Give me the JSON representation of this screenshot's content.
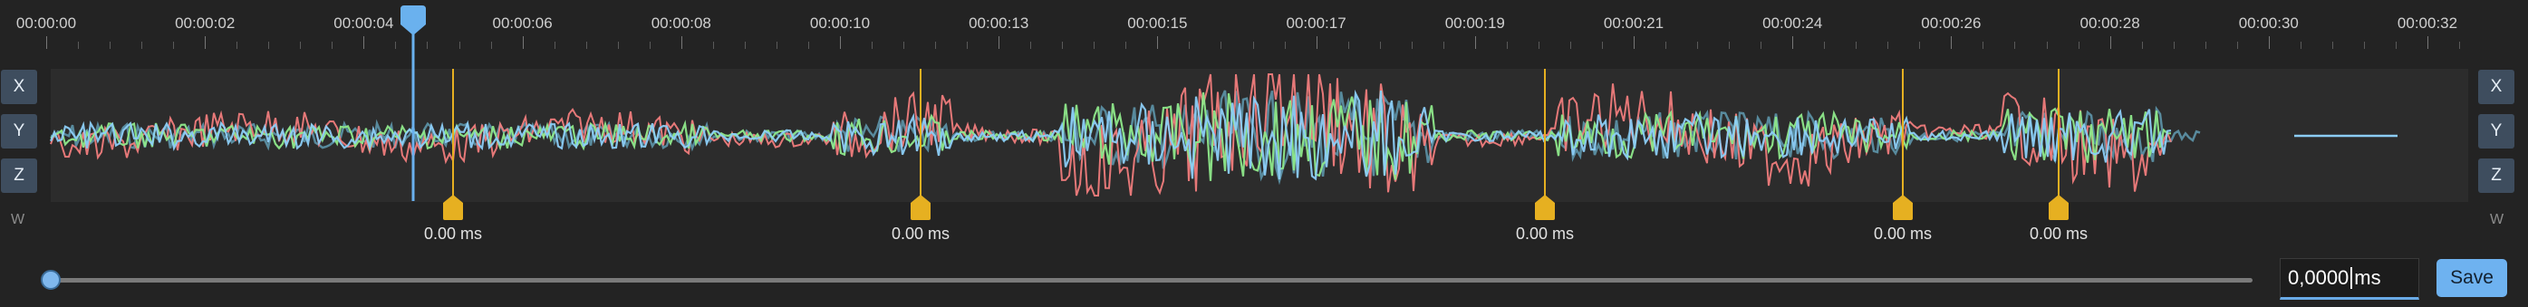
{
  "timeline": {
    "labels": [
      "00:00:00",
      "00:00:02",
      "00:00:04",
      "00:00:06",
      "00:00:08",
      "00:00:10",
      "00:00:13",
      "00:00:15",
      "00:00:17",
      "00:00:19",
      "00:00:21",
      "00:00:24",
      "00:00:26",
      "00:00:28",
      "00:00:30",
      "00:00:32"
    ]
  },
  "left_axis": {
    "x": "X",
    "y": "Y",
    "z": "Z",
    "w": "W"
  },
  "right_axis": {
    "x": "X",
    "y": "Y",
    "z": "Z",
    "w": "W"
  },
  "markers": [
    {
      "label": "0.00 ms"
    },
    {
      "label": "0.00 ms"
    },
    {
      "label": "0.00 ms"
    },
    {
      "label": "0.00 ms"
    },
    {
      "label": "0.00 ms"
    }
  ],
  "colors": {
    "x_series": "#f07c7c",
    "y_series": "#8ee88a",
    "z_series": "#8ccdf7",
    "w_series": "#5b8fa3",
    "marker": "#e6b021",
    "playhead": "#6ab1ee"
  },
  "icons": {
    "marker": "marker-pin-icon",
    "playhead": "playhead-icon"
  },
  "offset_input": {
    "value": "0,0000",
    "unit": "ms"
  },
  "save_label": "Save"
}
